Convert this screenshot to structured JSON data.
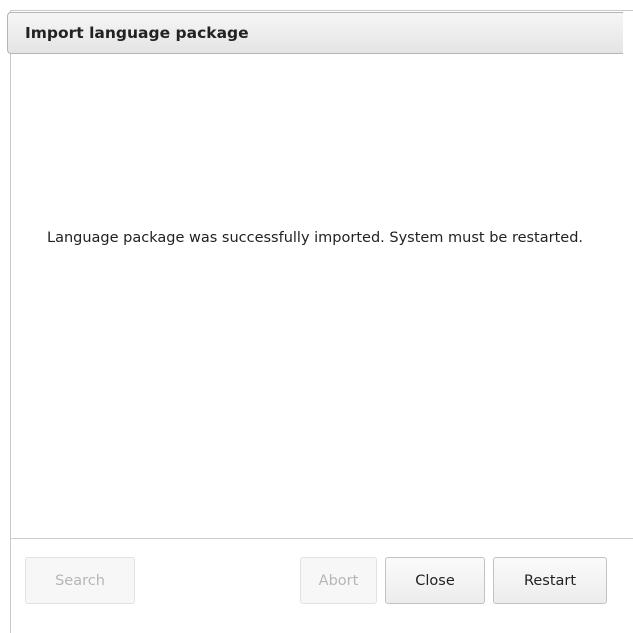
{
  "dialog": {
    "title": "Import language package",
    "message": "Language package was successfully imported. System must be restarted."
  },
  "footer": {
    "search_label": "Search",
    "abort_label": "Abort",
    "close_label": "Close",
    "restart_label": "Restart",
    "search_enabled": false,
    "abort_enabled": false,
    "close_enabled": true,
    "restart_enabled": true
  }
}
